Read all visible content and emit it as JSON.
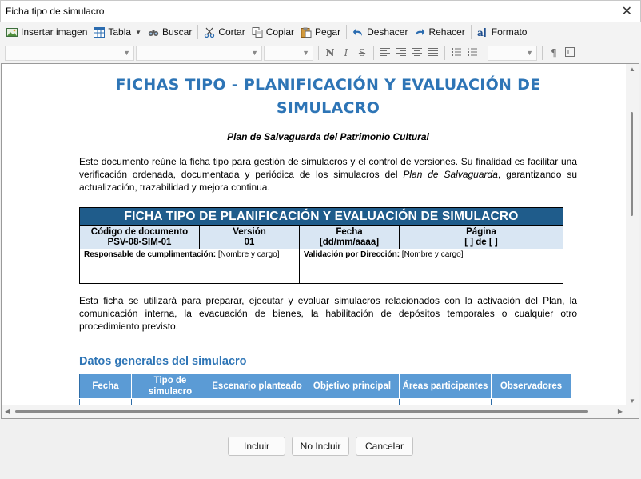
{
  "window": {
    "title": "Ficha tipo de simulacro",
    "close_glyph": "✕"
  },
  "toolbar": {
    "insert_image": "Insertar imagen",
    "table": "Tabla",
    "search": "Buscar",
    "cut": "Cortar",
    "copy": "Copiar",
    "paste": "Pegar",
    "undo": "Deshacer",
    "redo": "Rehacer",
    "format": "Formato"
  },
  "format_bar": {
    "bold": "N",
    "italic": "I",
    "strike": "S"
  },
  "document": {
    "title": "FICHAS TIPO - PLANIFICACIÓN Y EVALUACIÓN DE SIMULACRO",
    "subtitle": "Plan de Salvaguarda del Patrimonio Cultural",
    "intro_a": "Este documento reúne la ficha tipo para gestión de simulacros y el control de versiones. Su finalidad es facilitar una verificación ordenada, documentada y periódica de los simulacros del ",
    "intro_em": "Plan de Salvaguarda",
    "intro_b": ", garantizando su actualización, trazabilidad y mejora continua.",
    "ficha": {
      "header": "FICHA TIPO DE PLANIFICACIÓN Y EVALUACIÓN DE SIMULACRO",
      "code_label": "Código de documento",
      "code_value": "PSV-08-SIM-01",
      "version_label": "Versión",
      "version_value": "01",
      "date_label": "Fecha",
      "date_value": "[dd/mm/aaaa]",
      "page_label": "Página",
      "page_value": "[ ] de [ ]",
      "responsible_label": "Responsable de cumplimentación:",
      "responsible_value": " [Nombre y cargo]",
      "validation_label": "Validación por Dirección:",
      "validation_value": " [Nombre y cargo]"
    },
    "usage": "Esta ficha se utilizará para preparar, ejecutar y evaluar simulacros relacionados con la activación del Plan, la comunicación interna, la evacuación de bienes, la habilitación de depósitos temporales o cualquier otro procedimiento previsto.",
    "general_title": "Datos generales del simulacro",
    "general_columns": [
      "Fecha",
      "Tipo de simulacro",
      "Escenario planteado",
      "Objetivo principal",
      "Áreas participantes",
      "Observadores"
    ]
  },
  "buttons": {
    "include": "Incluir",
    "exclude": "No Incluir",
    "cancel": "Cancelar"
  }
}
